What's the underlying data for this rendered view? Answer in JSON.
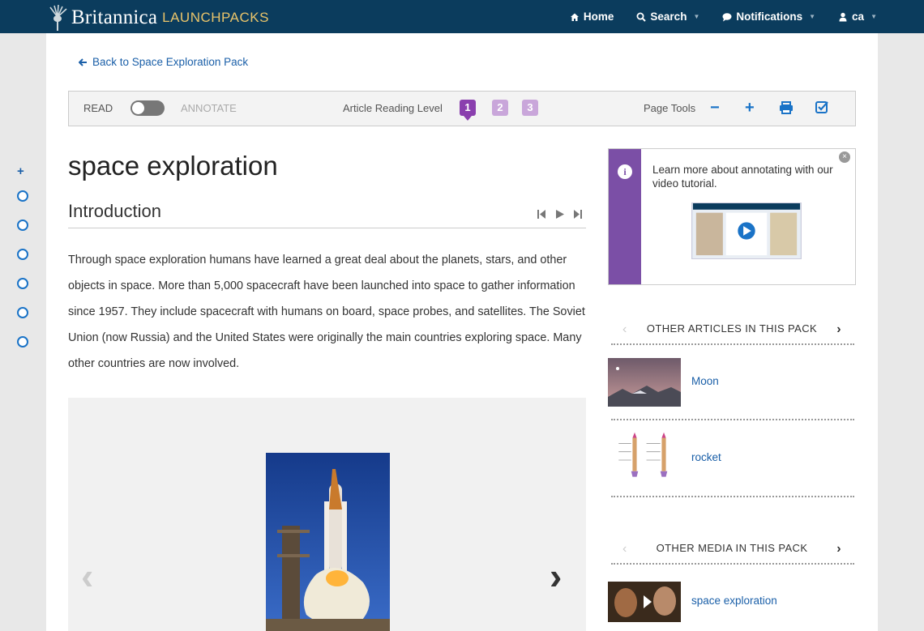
{
  "header": {
    "brand_name": "Britannica",
    "brand_product": "LAUNCHPACKS",
    "nav": [
      {
        "label": "Home",
        "icon": "home-icon"
      },
      {
        "label": "Search",
        "icon": "search-icon"
      },
      {
        "label": "Notifications",
        "icon": "chat-bubble-icon"
      },
      {
        "label": "ca",
        "icon": "user-icon"
      }
    ]
  },
  "back_link": "Back to Space Exploration Pack",
  "toolbar": {
    "read": "READ",
    "annotate": "ANNOTATE",
    "reading_level_label": "Article Reading Level",
    "levels": [
      "1",
      "2",
      "3"
    ],
    "active_level": "1",
    "page_tools": "Page Tools"
  },
  "article": {
    "title": "space exploration",
    "section": "Introduction",
    "body": "Through space exploration humans have learned a great deal about the planets, stars, and other objects in space. More than 5,000 spacecraft have been launched into space to gather information since 1957. They include spacecraft with humans on board, space probes, and satellites. The Soviet Union (now Russia) and the United States were originally the main countries exploring space. Many other countries are now involved."
  },
  "tip": {
    "text": "Learn more about annotating with our video tutorial."
  },
  "other_articles": {
    "heading": "OTHER ARTICLES IN THIS PACK",
    "items": [
      {
        "label": "Moon"
      },
      {
        "label": "rocket"
      }
    ]
  },
  "other_media": {
    "heading": "OTHER MEDIA IN THIS PACK",
    "items": [
      {
        "label": "space exploration"
      }
    ]
  },
  "colors": {
    "header_bg": "#0b3c5d",
    "link": "#1a5fa8",
    "level_active": "#8a3fae",
    "tip_bar": "#7b4fa6"
  }
}
